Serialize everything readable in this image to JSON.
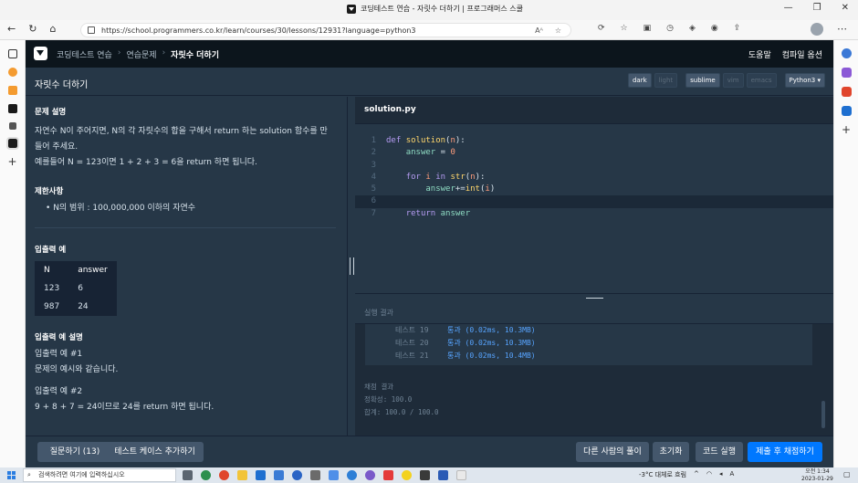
{
  "browser": {
    "tab_title": "코딩테스트 연습 - 자릿수 더하기 | 프로그래머스 스쿨",
    "url": "https://school.programmers.co.kr/learn/courses/30/lessons/12931?language=python3",
    "reader_label": "Aᴬ"
  },
  "header": {
    "breadcrumbs": [
      "코딩테스트 연습",
      "연습문제",
      "자릿수 더하기"
    ],
    "help": "도움말",
    "compile_options": "컴파일 옵션"
  },
  "lesson": {
    "title": "자릿수 더하기",
    "theme_options": [
      "dark",
      "light"
    ],
    "keymap_options": [
      "sublime",
      "vim",
      "emacs"
    ],
    "language": "Python3"
  },
  "problem": {
    "desc_heading": "문제 설명",
    "desc_lines": [
      "자연수 N이 주어지면, N의 각 자릿수의 합을 구해서 return 하는 solution 함수를 만",
      "들어 주세요.",
      "예를들어 N = 123이면 1 + 2 + 3 = 6을 return 하면 됩니다."
    ],
    "limits_heading": "제한사항",
    "limit_item": "N의 범위 : 100,000,000 이하의 자연수",
    "io_heading": "입출력 예",
    "io_table": {
      "headers": [
        "N",
        "answer"
      ],
      "rows": [
        [
          "123",
          "6"
        ],
        [
          "987",
          "24"
        ]
      ]
    },
    "io_explain_heading": "입출력 예 설명",
    "example1_title": "입출력 예 #1",
    "example1_text": "문제의 예시와 같습니다.",
    "example2_title": "입출력 예 #2",
    "example2_text": "9 + 8 + 7 = 24이므로 24를 return 하면 됩니다."
  },
  "editor": {
    "filename": "solution.py",
    "line_numbers": [
      "1",
      "2",
      "3",
      "4",
      "5",
      "6",
      "7"
    ]
  },
  "results": {
    "heading": "실행 결과",
    "tests": [
      {
        "name": "테스트 19",
        "result": "통과 (0.02ms, 10.3MB)"
      },
      {
        "name": "테스트 20",
        "result": "통과 (0.02ms, 10.3MB)"
      },
      {
        "name": "테스트 21",
        "result": "통과 (0.02ms, 10.4MB)"
      }
    ],
    "final_heading": "채점 결과",
    "accuracy": "정확성: 100.0",
    "total": "합계: 100.0 / 100.0"
  },
  "actions": {
    "ask": "질문하기 (13)",
    "add_testcase": "테스트 케이스 추가하기",
    "others": "다른 사람의 풀이",
    "reset": "초기화",
    "run": "코드 실행",
    "submit": "제출 후 채점하기"
  },
  "taskbar": {
    "search_placeholder": "검색하려면 여기에 입력하십시오",
    "weather": "-3°C 대체로 흐림",
    "ime": "A",
    "time": "오전 1:34",
    "date": "2023-01-29"
  },
  "colors": {
    "panel": "#263747",
    "header": "#0c151c",
    "primary": "#0078ff",
    "pass": "#57a4ff"
  }
}
